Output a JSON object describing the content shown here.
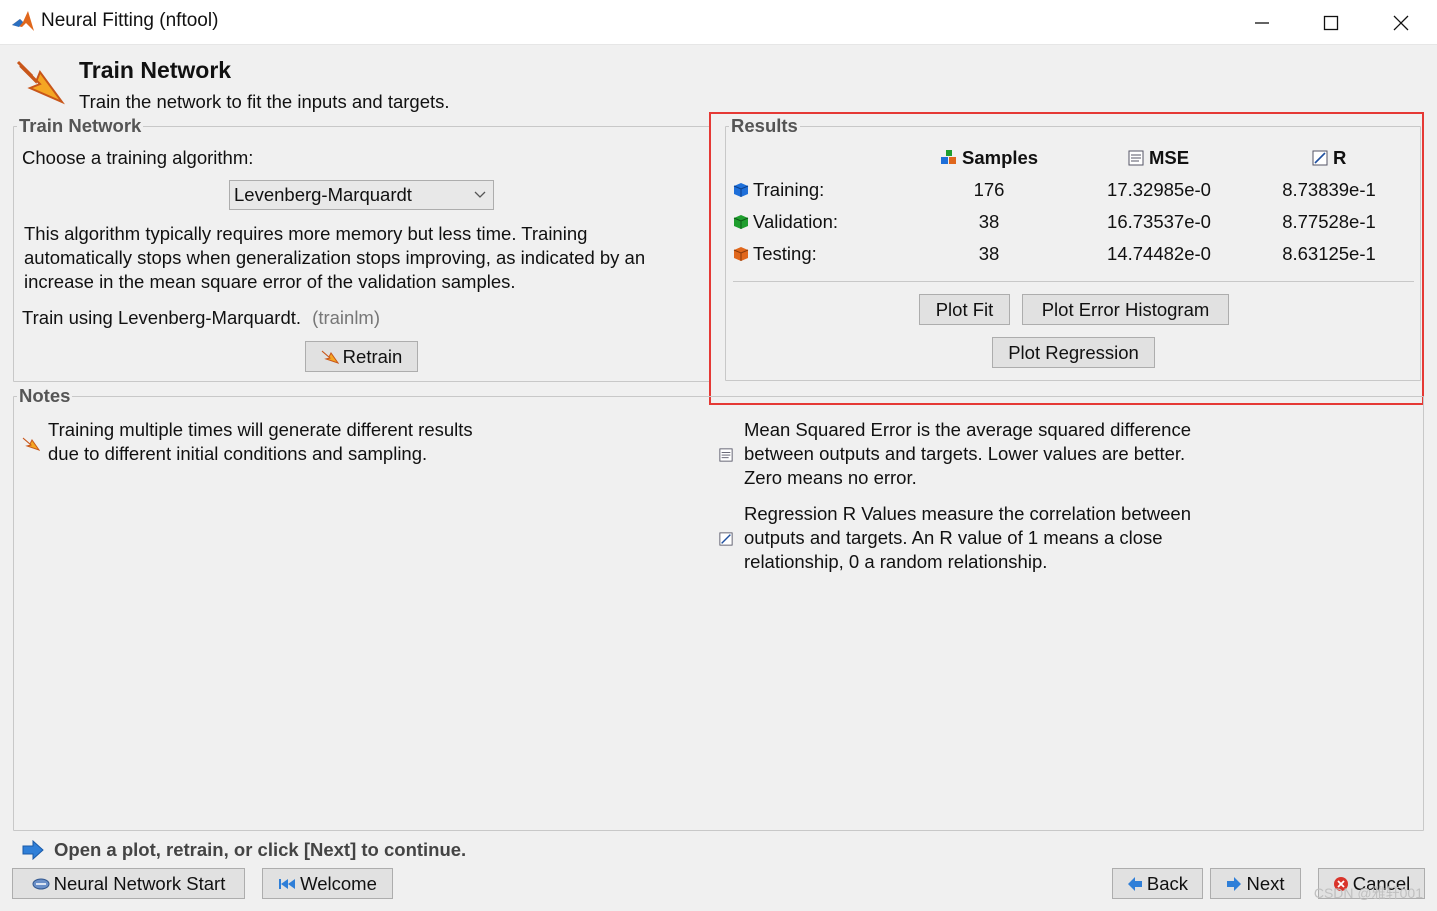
{
  "window": {
    "title": "Neural Fitting (nftool)",
    "icon": "matlab-icon",
    "controls": [
      "minimize-icon",
      "maximize-icon",
      "close-icon"
    ]
  },
  "header": {
    "title": "Train Network",
    "subtitle": "Train the network to fit the inputs and targets."
  },
  "train_panel": {
    "label": "Train Network",
    "choose_label": "Choose a training algorithm:",
    "algorithm_selected": "Levenberg-Marquardt",
    "description_lines": [
      "This algorithm typically requires more memory but less time. Training",
      "automatically stops when generalization stops improving, as indicated by an",
      "increase in the mean square error of the validation samples."
    ],
    "train_using": "Train using Levenberg-Marquardt.",
    "train_fn": "(trainlm)",
    "retrain_label": "Retrain"
  },
  "results": {
    "label": "Results",
    "headers": {
      "samples": "Samples",
      "mse": "MSE",
      "r": "R"
    },
    "rows": [
      {
        "label": "Training:",
        "samples": "176",
        "mse": "17.32985e-0",
        "r": "8.73839e-1",
        "color": "#1e6fd9"
      },
      {
        "label": "Validation:",
        "samples": "38",
        "mse": "16.73537e-0",
        "r": "8.77528e-1",
        "color": "#1f9e2e"
      },
      {
        "label": "Testing:",
        "samples": "38",
        "mse": "14.74482e-0",
        "r": "8.63125e-1",
        "color": "#e0671c"
      }
    ],
    "buttons": {
      "plot_fit": "Plot Fit",
      "plot_error_histogram": "Plot Error Histogram",
      "plot_regression": "Plot Regression"
    }
  },
  "notes": {
    "label": "Notes",
    "training_note": [
      "Training multiple times will generate different results",
      "due to different initial conditions and sampling."
    ],
    "mse_note": [
      "Mean Squared Error is the average squared difference",
      "between outputs and targets. Lower values are better.",
      "Zero means no error."
    ],
    "r_note": [
      "Regression R Values measure the correlation between",
      "outputs and targets. An R value of 1 means a close",
      "relationship, 0 a random relationship."
    ]
  },
  "status": "Open a plot, retrain, or click [Next] to continue.",
  "footer": {
    "nn_start": "Neural Network Start",
    "welcome": "Welcome",
    "back": "Back",
    "next": "Next",
    "cancel": "Cancel"
  },
  "watermark": "CSDN @雅轩001",
  "colors": {
    "highlight": "#e53935",
    "arrow_blue": "#2f7fd8"
  }
}
